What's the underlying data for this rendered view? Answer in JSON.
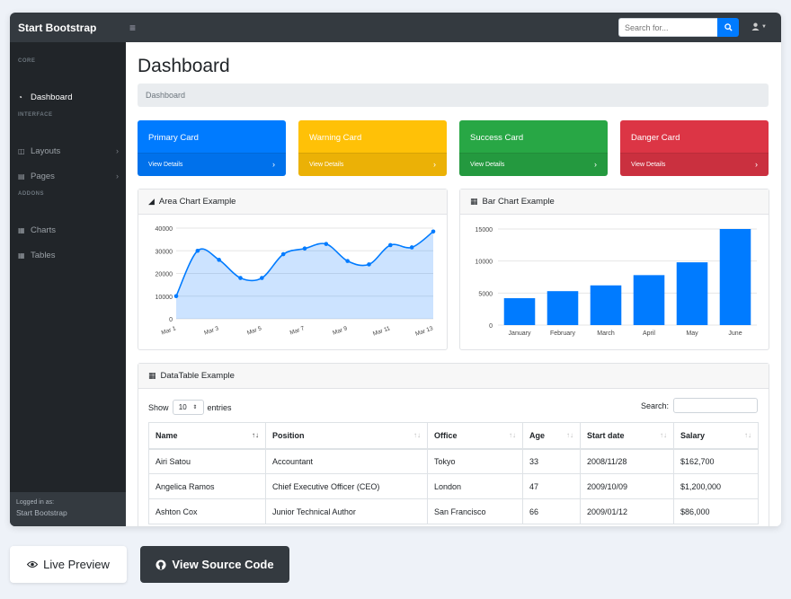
{
  "topnav": {
    "brand": "Start Bootstrap",
    "search_placeholder": "Search for..."
  },
  "sidebar": {
    "sections": [
      {
        "heading": "Core",
        "items": [
          {
            "label": "Dashboard",
            "icon": "tachometer-icon",
            "active": true
          }
        ]
      },
      {
        "heading": "Interface",
        "items": [
          {
            "label": "Layouts",
            "icon": "columns-icon"
          },
          {
            "label": "Pages",
            "icon": "book-icon"
          }
        ]
      },
      {
        "heading": "Addons",
        "items": [
          {
            "label": "Charts",
            "icon": "chart-area-icon"
          },
          {
            "label": "Tables",
            "icon": "table-icon"
          }
        ]
      }
    ],
    "footer": {
      "small": "Logged in as:",
      "name": "Start Bootstrap"
    }
  },
  "main": {
    "title": "Dashboard",
    "breadcrumb": "Dashboard"
  },
  "cards": [
    {
      "title": "Primary Card",
      "footer": "View Details",
      "color": "#007bff",
      "text_color": "#ffffff"
    },
    {
      "title": "Warning Card",
      "footer": "View Details",
      "color": "#ffc107",
      "text_color": "#ffffff"
    },
    {
      "title": "Success Card",
      "footer": "View Details",
      "color": "#28a745",
      "text_color": "#ffffff"
    },
    {
      "title": "Danger Card",
      "footer": "View Details",
      "color": "#dc3545",
      "text_color": "#ffffff"
    }
  ],
  "area_panel": {
    "title": "Area Chart Example"
  },
  "bar_panel": {
    "title": "Bar Chart Example"
  },
  "chart_data": [
    {
      "type": "area",
      "x": [
        "Mar 1",
        "Mar 2",
        "Mar 3",
        "Mar 4",
        "Mar 5",
        "Mar 6",
        "Mar 7",
        "Mar 8",
        "Mar 9",
        "Mar 10",
        "Mar 11",
        "Mar 12",
        "Mar 13"
      ],
      "values": [
        10000,
        30000,
        26000,
        18000,
        18000,
        28500,
        31000,
        33000,
        25500,
        24000,
        32500,
        31500,
        38500
      ],
      "xticks": [
        "Mar 1",
        "Mar 3",
        "Mar 5",
        "Mar 7",
        "Mar 9",
        "Mar 11",
        "Mar 13"
      ],
      "yticks": [
        0,
        10000,
        20000,
        30000,
        40000
      ],
      "ylim": [
        0,
        40000
      ],
      "color": "#007bff",
      "grid": true
    },
    {
      "type": "bar",
      "categories": [
        "January",
        "February",
        "March",
        "April",
        "May",
        "June"
      ],
      "values": [
        4200,
        5300,
        6200,
        7800,
        9800,
        15000
      ],
      "yticks": [
        0,
        5000,
        10000,
        15000
      ],
      "ylim": [
        0,
        15000
      ],
      "color": "#007bff",
      "grid": true
    }
  ],
  "datatable": {
    "title": "DataTable Example",
    "show_label": "Show",
    "entries_value": "10",
    "entries_label": "entries",
    "search_label": "Search:",
    "columns": [
      "Name",
      "Position",
      "Office",
      "Age",
      "Start date",
      "Salary"
    ],
    "rows": [
      [
        "Airi Satou",
        "Accountant",
        "Tokyo",
        "33",
        "2008/11/28",
        "$162,700"
      ],
      [
        "Angelica Ramos",
        "Chief Executive Officer (CEO)",
        "London",
        "47",
        "2009/10/09",
        "$1,200,000"
      ],
      [
        "Ashton Cox",
        "Junior Technical Author",
        "San Francisco",
        "66",
        "2009/01/12",
        "$86,000"
      ]
    ]
  },
  "actions": {
    "live_preview": "Live Preview",
    "view_source": "View Source Code"
  }
}
